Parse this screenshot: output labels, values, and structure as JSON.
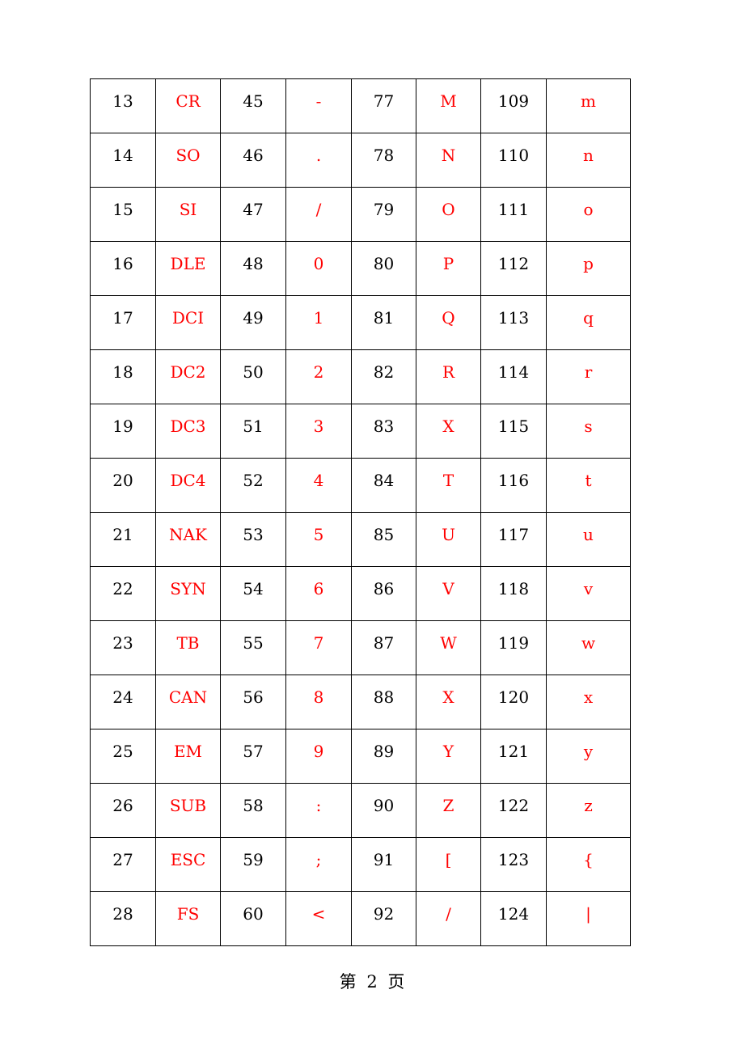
{
  "table": {
    "rows": [
      [
        "13",
        "CR",
        "45",
        "-",
        "77",
        "M",
        "109",
        "m"
      ],
      [
        "14",
        "SO",
        "46",
        ".",
        "78",
        "N",
        "110",
        "n"
      ],
      [
        "15",
        "SI",
        "47",
        "/",
        "79",
        "O",
        "111",
        "o"
      ],
      [
        "16",
        "DLE",
        "48",
        "0",
        "80",
        "P",
        "112",
        "p"
      ],
      [
        "17",
        "DCI",
        "49",
        "1",
        "81",
        "Q",
        "113",
        "q"
      ],
      [
        "18",
        "DC2",
        "50",
        "2",
        "82",
        "R",
        "114",
        "r"
      ],
      [
        "19",
        "DC3",
        "51",
        "3",
        "83",
        "X",
        "115",
        "s"
      ],
      [
        "20",
        "DC4",
        "52",
        "4",
        "84",
        "T",
        "116",
        "t"
      ],
      [
        "21",
        "NAK",
        "53",
        "5",
        "85",
        "U",
        "117",
        "u"
      ],
      [
        "22",
        "SYN",
        "54",
        "6",
        "86",
        "V",
        "118",
        "v"
      ],
      [
        "23",
        "TB",
        "55",
        "7",
        "87",
        "W",
        "119",
        "w"
      ],
      [
        "24",
        "CAN",
        "56",
        "8",
        "88",
        "X",
        "120",
        "x"
      ],
      [
        "25",
        "EM",
        "57",
        "9",
        "89",
        "Y",
        "121",
        "y"
      ],
      [
        "26",
        "SUB",
        "58",
        ":",
        "90",
        "Z",
        "122",
        "z"
      ],
      [
        "27",
        "ESC",
        "59",
        ";",
        "91",
        "[",
        "123",
        "{"
      ],
      [
        "28",
        "FS",
        "60",
        "<",
        "92",
        "/",
        "124",
        "|"
      ]
    ]
  },
  "colors": {
    "code": "#000000",
    "char": "#ff0000"
  },
  "footer": {
    "page_label": "第 2 页"
  }
}
